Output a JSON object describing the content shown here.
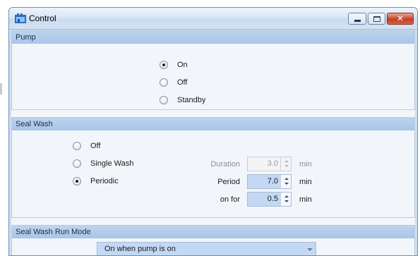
{
  "window": {
    "title": "Control",
    "controls": {
      "minimize": "minimize",
      "maximize": "maximize",
      "close": "close"
    }
  },
  "pump": {
    "heading": "Pump",
    "options": [
      {
        "label": "On",
        "checked": true
      },
      {
        "label": "Off",
        "checked": false
      },
      {
        "label": "Standby",
        "checked": false
      }
    ]
  },
  "seal_wash": {
    "heading": "Seal Wash",
    "options": [
      {
        "label": "Off",
        "checked": false
      },
      {
        "label": "Single Wash",
        "checked": false
      },
      {
        "label": "Periodic",
        "checked": true
      }
    ],
    "fields": [
      {
        "label": "Duration",
        "value": "3.0",
        "unit": "min",
        "enabled": false
      },
      {
        "label": "Period",
        "value": "7.0",
        "unit": "min",
        "enabled": true
      },
      {
        "label": "on for",
        "value": "0.5",
        "unit": "min",
        "enabled": true
      }
    ]
  },
  "run_mode": {
    "heading": "Seal Wash Run Mode",
    "selected": "On when pump is on"
  },
  "colors": {
    "section_header": "#a9c5e8",
    "panel_background": "#f2f6fb",
    "input_highlight": "#c3d8f4",
    "close_button": "#c0391f"
  },
  "icons": [
    "app-icon",
    "minimize-icon",
    "maximize-icon",
    "close-icon",
    "spin-up-icon",
    "spin-down-icon",
    "dropdown-arrow-icon"
  ]
}
